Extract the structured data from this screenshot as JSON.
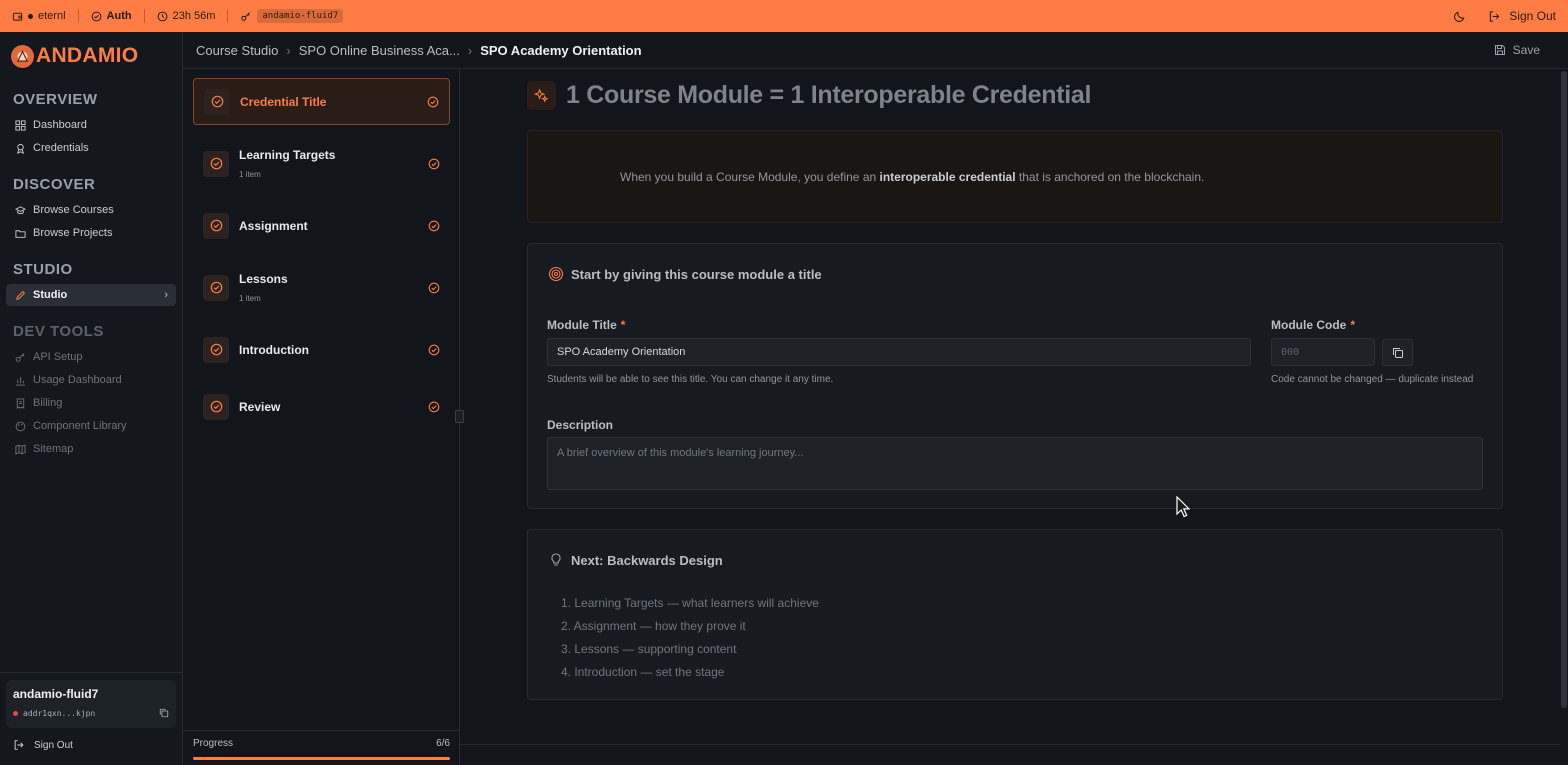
{
  "topbar": {
    "wallet": "eternl",
    "auth": "Auth",
    "timer": "23h 56m",
    "alias": "andamio-fluid7",
    "sign_out": "Sign Out"
  },
  "sidebar": {
    "brand": "ANDAMIO",
    "sections": [
      {
        "title": "OVERVIEW",
        "items": [
          {
            "label": "Dashboard",
            "icon": "grid-icon"
          },
          {
            "label": "Credentials",
            "icon": "award-icon"
          }
        ]
      },
      {
        "title": "DISCOVER",
        "items": [
          {
            "label": "Browse Courses",
            "icon": "graduation-cap-icon"
          },
          {
            "label": "Browse Projects",
            "icon": "folder-icon"
          }
        ]
      },
      {
        "title": "STUDIO",
        "items": [
          {
            "label": "Studio",
            "icon": "pencil-icon",
            "active": true
          }
        ]
      },
      {
        "title": "DEV TOOLS",
        "items": [
          {
            "label": "API Setup",
            "icon": "key-icon"
          },
          {
            "label": "Usage Dashboard",
            "icon": "bar-chart-icon"
          },
          {
            "label": "Billing",
            "icon": "receipt-icon"
          },
          {
            "label": "Component Library",
            "icon": "palette-icon"
          },
          {
            "label": "Sitemap",
            "icon": "map-icon"
          }
        ]
      }
    ],
    "user": {
      "name": "andamio-fluid7",
      "address": "addr1qxn...kjpn"
    },
    "sign_out": "Sign Out"
  },
  "breadcrumb": {
    "items": [
      "Course Studio",
      "SPO Online Business Aca..."
    ],
    "current": "SPO Academy Orientation",
    "save_label": "Save"
  },
  "steps": [
    {
      "title": "Credential Title",
      "sub": "",
      "active": true
    },
    {
      "title": "Learning Targets",
      "sub": "1 item",
      "active": false
    },
    {
      "title": "Assignment",
      "sub": "",
      "active": false
    },
    {
      "title": "Lessons",
      "sub": "1 item",
      "active": false
    },
    {
      "title": "Introduction",
      "sub": "",
      "active": false
    },
    {
      "title": "Review",
      "sub": "",
      "active": false
    }
  ],
  "progress": {
    "label": "Progress",
    "count": "6/6",
    "fraction": 1.0
  },
  "main": {
    "heading": "1 Course Module = 1 Interoperable Credential",
    "callout": {
      "before": "When you build a Course Module, you define an ",
      "bold": "interoperable credential",
      "after": " that is anchored on the blockchain."
    },
    "form_card": {
      "title": "Start by giving this course module a title",
      "module_title_label": "Module Title",
      "module_title_value": "SPO Academy Orientation",
      "module_title_help": "Students will be able to see this title. You can change it any time.",
      "module_code_label": "Module Code",
      "module_code_placeholder": "000",
      "module_code_help": "Code cannot be changed — duplicate instead",
      "description_label": "Description",
      "description_placeholder": "A brief overview of this module's learning journey..."
    },
    "next_card": {
      "title": "Next: Backwards Design",
      "items": [
        "1. Learning Targets — what learners will achieve",
        "2. Assignment — how they prove it",
        "3. Lessons — supporting content",
        "4. Introduction — set the stage"
      ]
    }
  },
  "colors": {
    "accent": "#ff7d45",
    "background": "#12151b",
    "panel": "#171a20"
  }
}
